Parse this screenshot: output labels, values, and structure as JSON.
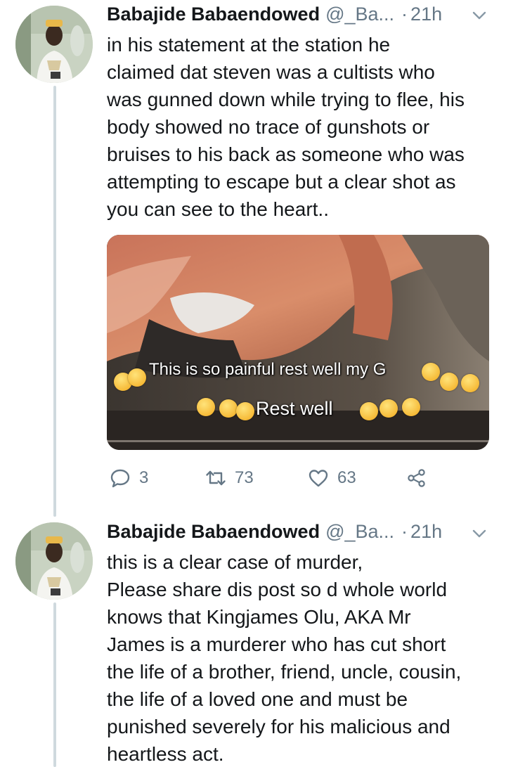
{
  "tweets": [
    {
      "author_name": "Babajide Babaendowed",
      "author_handle": "@_Ba...",
      "separator": "·",
      "time": "21h",
      "text": "in his statement at the station he\nclaimed dat steven was a cultists who\nwas gunned down while trying to flee, his\nbody showed no trace of gunshots or\nbruises to his back as someone who was\nattempting to escape but a clear shot as\nyou can see to the heart..",
      "media": {
        "caption_line1": "This is so painful rest well my G",
        "caption_line2": "Rest well"
      },
      "actions": {
        "reply_count": "3",
        "retweet_count": "73",
        "like_count": "63"
      }
    },
    {
      "author_name": "Babajide Babaendowed",
      "author_handle": "@_Ba...",
      "separator": "·",
      "time": "21h",
      "text": "this is a clear case of murder,\nPlease share dis post so d whole world\nknows that Kingjames Olu, AKA Mr\nJames is a murderer who has cut short\nthe life of a brother, friend, uncle, cousin,\nthe life of a loved one and must be\npunished severely for his malicious and\nheartless act."
    }
  ],
  "icons": {
    "reply": "reply-icon",
    "retweet": "retweet-icon",
    "like": "heart-icon",
    "share": "share-icon",
    "caret": "chevron-down-icon"
  },
  "colors": {
    "text": "#14171a",
    "secondary": "#657786",
    "thread_line": "#cfd9de"
  }
}
